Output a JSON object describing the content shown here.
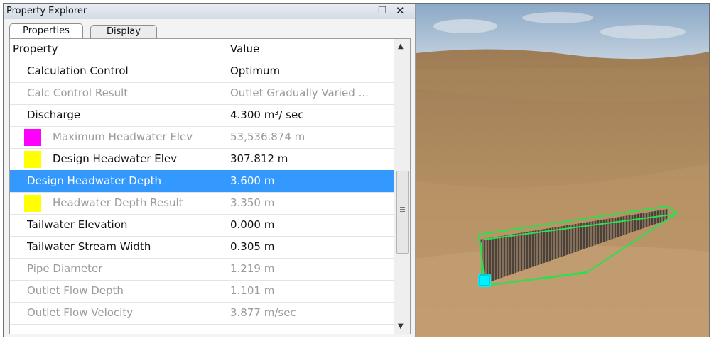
{
  "panel": {
    "title": "Property Explorer",
    "pin_icon": "pin-icon",
    "close_icon": "close-icon",
    "pin_glyph": "❐",
    "close_glyph": "✕"
  },
  "tabs": [
    {
      "label": "Properties"
    },
    {
      "label": "Display"
    }
  ],
  "table": {
    "headers": {
      "property": "Property",
      "value": "Value"
    },
    "rows": [
      {
        "name": "Calculation Control",
        "value": "Optimum"
      },
      {
        "name": "Calc Control Result",
        "value": "Outlet Gradually Varied ..."
      },
      {
        "name": "Discharge",
        "value": "4.300 m³/ sec"
      },
      {
        "name": "Maximum Headwater Elev",
        "value": "53,536.874 m",
        "swatch": "#ff00ff"
      },
      {
        "name": "Design Headwater Elev",
        "value": "307.812 m",
        "swatch": "#ffff00"
      },
      {
        "name": "Design Headwater Depth",
        "value": "3.600 m"
      },
      {
        "name": "Headwater Depth Result",
        "value": "3.350 m",
        "swatch": "#ffff00"
      },
      {
        "name": "Tailwater Elevation",
        "value": "0.000 m"
      },
      {
        "name": "Tailwater Stream Width",
        "value": "0.305 m"
      },
      {
        "name": "Pipe Diameter",
        "value": "1.219 m"
      },
      {
        "name": "Outlet Flow Depth",
        "value": "1.101 m"
      },
      {
        "name": "Outlet Flow Velocity",
        "value": "3.877 m/sec"
      }
    ]
  },
  "colors": {
    "selection": "#3399ff",
    "disabled_text": "#9b9b9b",
    "terrain": "#b99163",
    "culvert_outline": "#29e14f",
    "endpoint": "#00f0ff"
  }
}
